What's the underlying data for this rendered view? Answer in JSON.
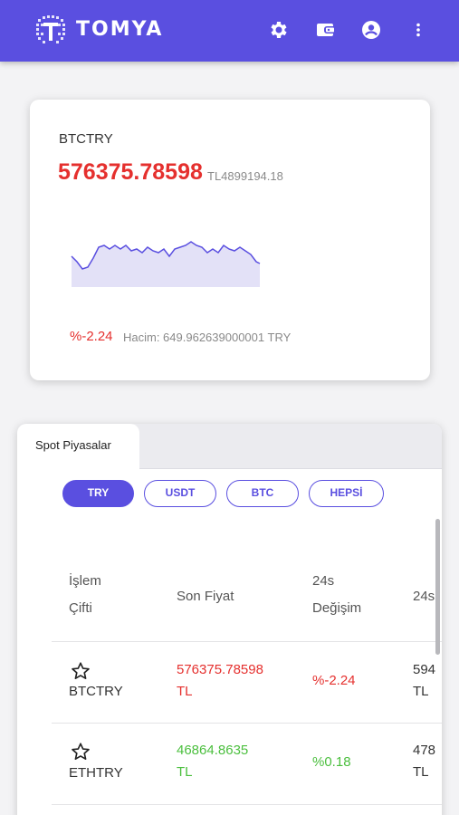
{
  "header": {
    "brand": "TOMYA",
    "icons": [
      "settings-icon",
      "wallet-icon",
      "account-icon",
      "more-vert-icon"
    ],
    "accent": "#5a4fe0"
  },
  "ticker": {
    "pair": "BTCTRY",
    "price": "576375.78598",
    "price_tl": "TL4899194.18",
    "change": "%-2.24",
    "volume": "Hacim: 649.962639000001 TRY"
  },
  "market": {
    "tab": "Spot Piyasalar",
    "filters": [
      "TRY",
      "USDT",
      "BTC",
      "HEPSİ"
    ],
    "active_filter": "TRY",
    "columns": {
      "pair_l1": "İşlem",
      "pair_l2": "Çifti",
      "last_price": "Son Fiyat",
      "change_l1": "24s",
      "change_l2": "Değişim",
      "next": "24s"
    },
    "rows": [
      {
        "pair": "BTCTRY",
        "price": "576375.78598",
        "unit": "TL",
        "change": "%-2.24",
        "next": "594",
        "next_unit": "TL"
      },
      {
        "pair": "ETHTRY",
        "price": "46864.8635",
        "unit": "TL",
        "change": "%0.18",
        "next": "478",
        "next_unit": "TL"
      }
    ]
  }
}
